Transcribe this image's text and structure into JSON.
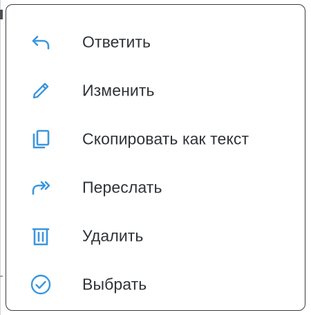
{
  "colors": {
    "icon_accent": "#3a96dd",
    "text": "#2f3337",
    "border": "#3a3a3a"
  },
  "menu": {
    "items": [
      {
        "label": "Ответить",
        "icon": "reply-icon"
      },
      {
        "label": "Изменить",
        "icon": "pencil-icon"
      },
      {
        "label": "Скопировать как текст",
        "icon": "copy-icon"
      },
      {
        "label": "Переслать",
        "icon": "forward-icon"
      },
      {
        "label": "Удалить",
        "icon": "trash-icon"
      },
      {
        "label": "Выбрать",
        "icon": "check-circle-icon"
      }
    ]
  }
}
